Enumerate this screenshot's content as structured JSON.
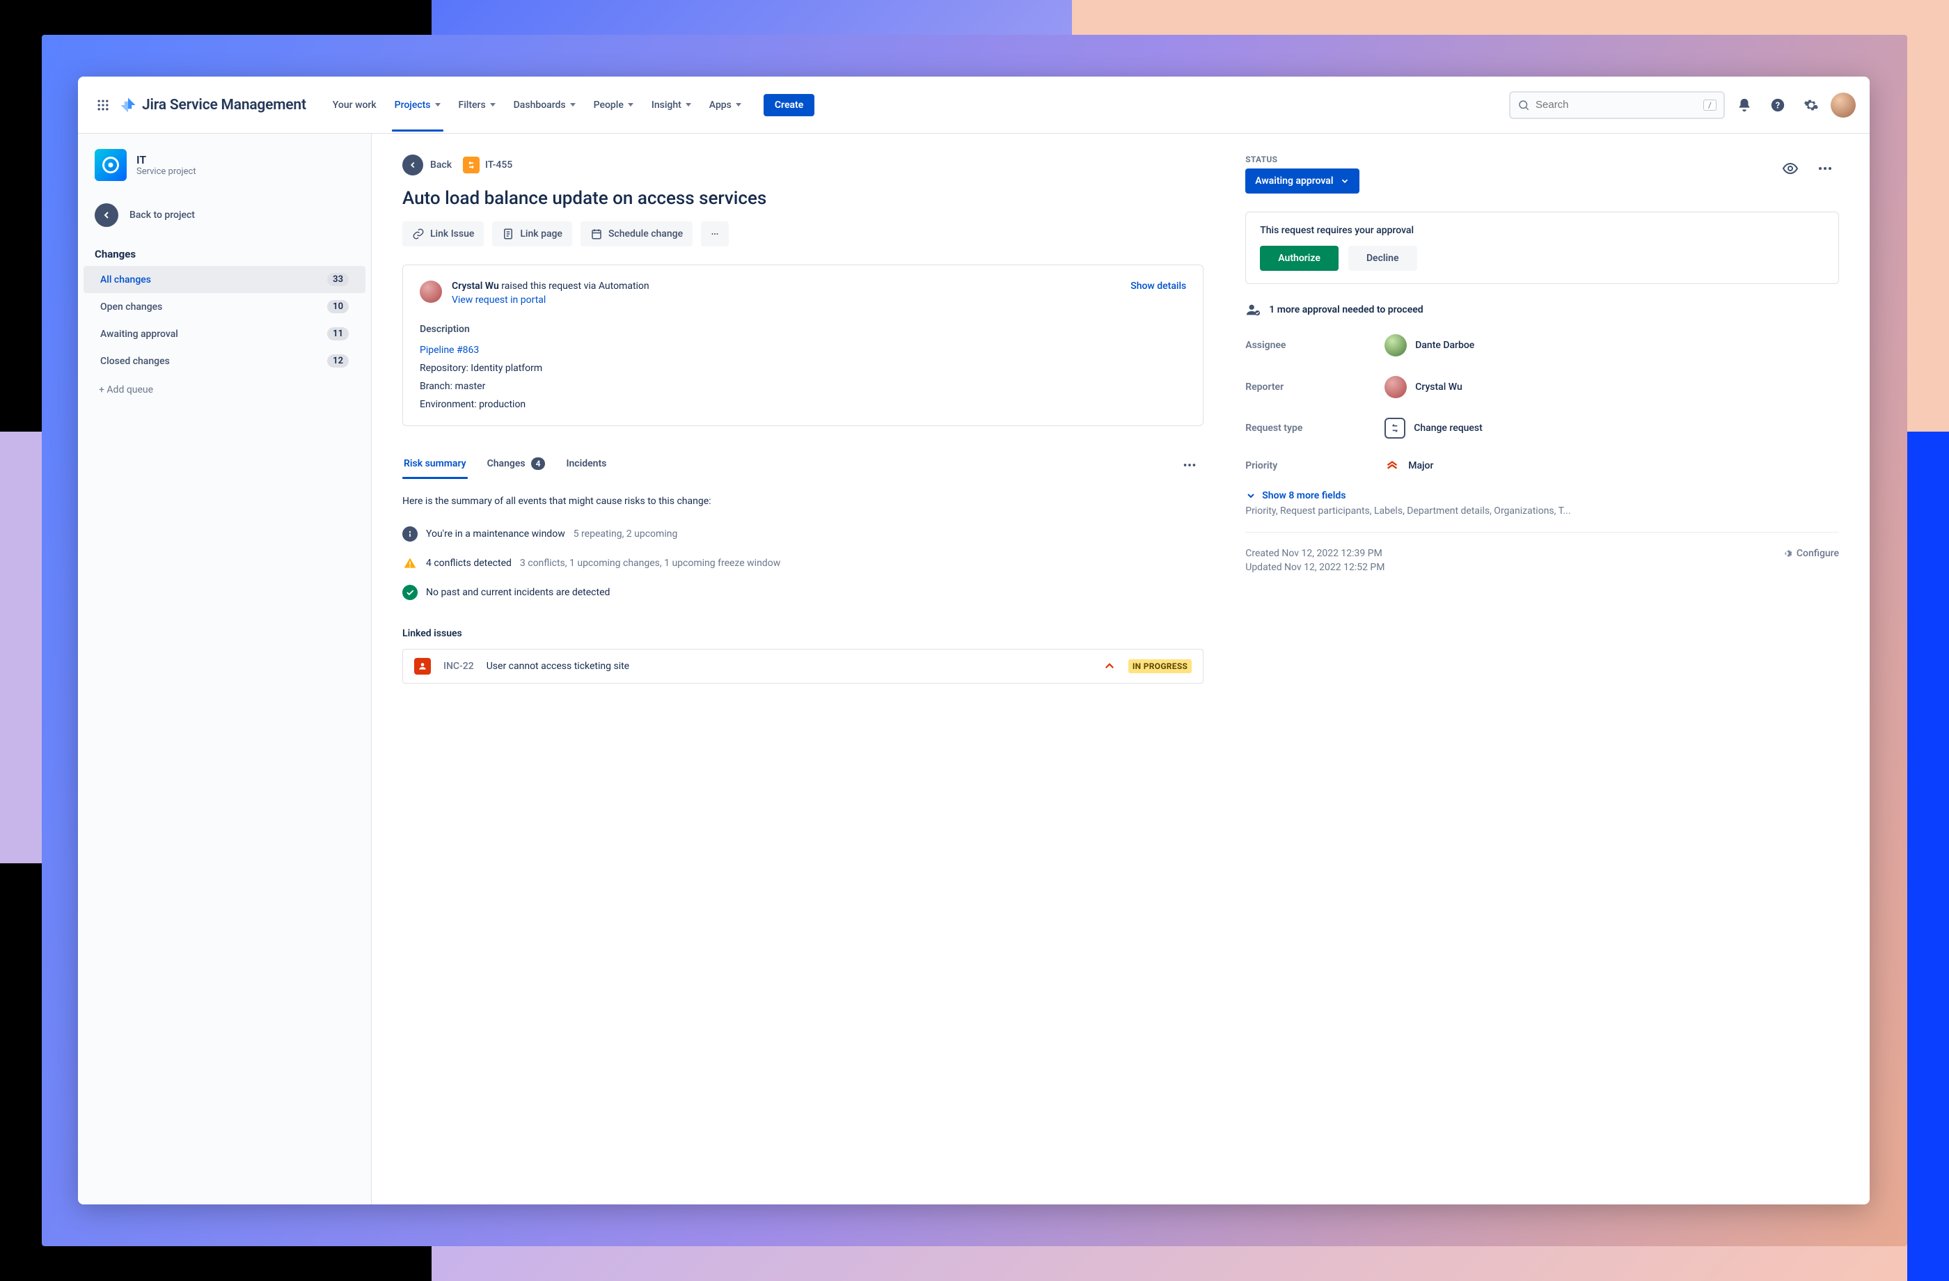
{
  "app_name": "Jira Service Management",
  "nav": {
    "items": [
      {
        "label": "Your work",
        "dropdown": false
      },
      {
        "label": "Projects",
        "dropdown": true,
        "active": true
      },
      {
        "label": "Filters",
        "dropdown": true
      },
      {
        "label": "Dashboards",
        "dropdown": true
      },
      {
        "label": "People",
        "dropdown": true
      },
      {
        "label": "Insight",
        "dropdown": true
      },
      {
        "label": "Apps",
        "dropdown": true
      }
    ],
    "create": "Create",
    "search_placeholder": "Search",
    "search_kbd": "/"
  },
  "sidebar": {
    "project_name": "IT",
    "project_subtitle": "Service project",
    "back_to_project": "Back to project",
    "section": "Changes",
    "queues": [
      {
        "label": "All changes",
        "count": "33",
        "active": true
      },
      {
        "label": "Open changes",
        "count": "10"
      },
      {
        "label": "Awaiting approval",
        "count": "11"
      },
      {
        "label": "Closed changes",
        "count": "12"
      }
    ],
    "add_queue": "+ Add queue"
  },
  "crumbs": {
    "back": "Back",
    "issue_key": "IT-455"
  },
  "issue": {
    "title": "Auto load balance update on access services",
    "actions": {
      "link_issue": "Link Issue",
      "link_page": "Link page",
      "schedule": "Schedule change"
    },
    "requester": {
      "name": "Crystal Wu",
      "line_suffix": " raised this request via Automation",
      "portal_link": "View request in portal",
      "show_details": "Show details"
    },
    "description": {
      "heading": "Description",
      "pipeline_link": "Pipeline #863",
      "lines": [
        "Repository: Identity platform",
        "Branch: master",
        "Environment: production"
      ]
    },
    "tabs": {
      "risk": "Risk summary",
      "changes": "Changes",
      "changes_count": "4",
      "incidents": "Incidents"
    },
    "risk": {
      "intro": "Here is the summary of all events that might cause risks to this change:",
      "rows": [
        {
          "icon": "info",
          "strong": "You're in a maintenance window",
          "muted": "5 repeating, 2 upcoming"
        },
        {
          "icon": "warn",
          "strong": "4 conflicts detected",
          "muted": "3 conflicts, 1 upcoming changes, 1 upcoming freeze window"
        },
        {
          "icon": "ok",
          "strong": "No past and current incidents are detected",
          "muted": ""
        }
      ]
    },
    "linked": {
      "heading": "Linked issues",
      "items": [
        {
          "key": "INC-22",
          "title": "User cannot access ticketing site",
          "status": "IN PROGRESS"
        }
      ]
    }
  },
  "details": {
    "status_label": "STATUS",
    "status_value": "Awaiting approval",
    "approval": {
      "message": "This request requires your approval",
      "authorize": "Authorize",
      "decline": "Decline"
    },
    "approvals_needed": "1 more approval needed to proceed",
    "fields": {
      "assignee": {
        "label": "Assignee",
        "value": "Dante Darboe"
      },
      "reporter": {
        "label": "Reporter",
        "value": "Crystal Wu"
      },
      "request_type": {
        "label": "Request type",
        "value": "Change request"
      },
      "priority": {
        "label": "Priority",
        "value": "Major"
      }
    },
    "show_more": "Show 8 more fields",
    "show_more_sub": "Priority, Request participants, Labels, Department details, Organizations, T...",
    "created": "Created Nov 12, 2022 12:39 PM",
    "updated": "Updated Nov 12, 2022 12:52 PM",
    "configure": "Configure"
  }
}
